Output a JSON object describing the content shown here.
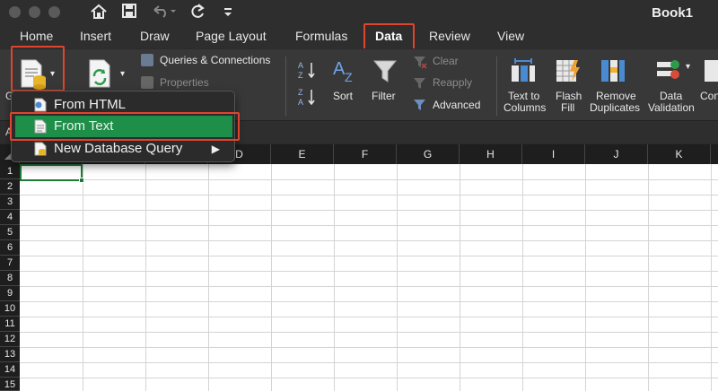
{
  "window": {
    "title": "Book1"
  },
  "quick_access": {
    "home_icon": "home-icon",
    "save_icon": "save-icon",
    "undo_icon": "undo-icon",
    "redo_icon": "redo-icon",
    "customize_icon": "customize-icon"
  },
  "tabs": [
    "Home",
    "Insert",
    "Draw",
    "Page Layout",
    "Formulas",
    "Data",
    "Review",
    "View"
  ],
  "active_tab": "Data",
  "ribbon": {
    "get_data_label": "G",
    "queries_connections": "Queries & Connections",
    "properties": "Properties",
    "sort": "Sort",
    "filter": "Filter",
    "clear": "Clear",
    "reapply": "Reapply",
    "advanced": "Advanced",
    "text_to_columns_1": "Text to",
    "text_to_columns_2": "Columns",
    "flash_fill_1": "Flash",
    "flash_fill_2": "Fill",
    "remove_duplicates_1": "Remove",
    "remove_duplicates_2": "Duplicates",
    "data_validation_1": "Data",
    "data_validation_2": "Validation",
    "consolidate_partial": "Con"
  },
  "dropdown": {
    "items": [
      "From HTML",
      "From Text",
      "New Database Query"
    ],
    "selected": "From Text"
  },
  "grid": {
    "name_box_fragment": "A",
    "columns": [
      "D",
      "E",
      "F",
      "G",
      "H",
      "I",
      "J",
      "K"
    ],
    "rows": [
      "1",
      "2",
      "3",
      "4",
      "5",
      "6",
      "7",
      "8",
      "9",
      "10",
      "11",
      "12",
      "13",
      "14",
      "15"
    ]
  },
  "colors": {
    "accent_green": "#1e8f48",
    "highlight_red": "#e0442c",
    "ribbon_bg": "#383838"
  }
}
